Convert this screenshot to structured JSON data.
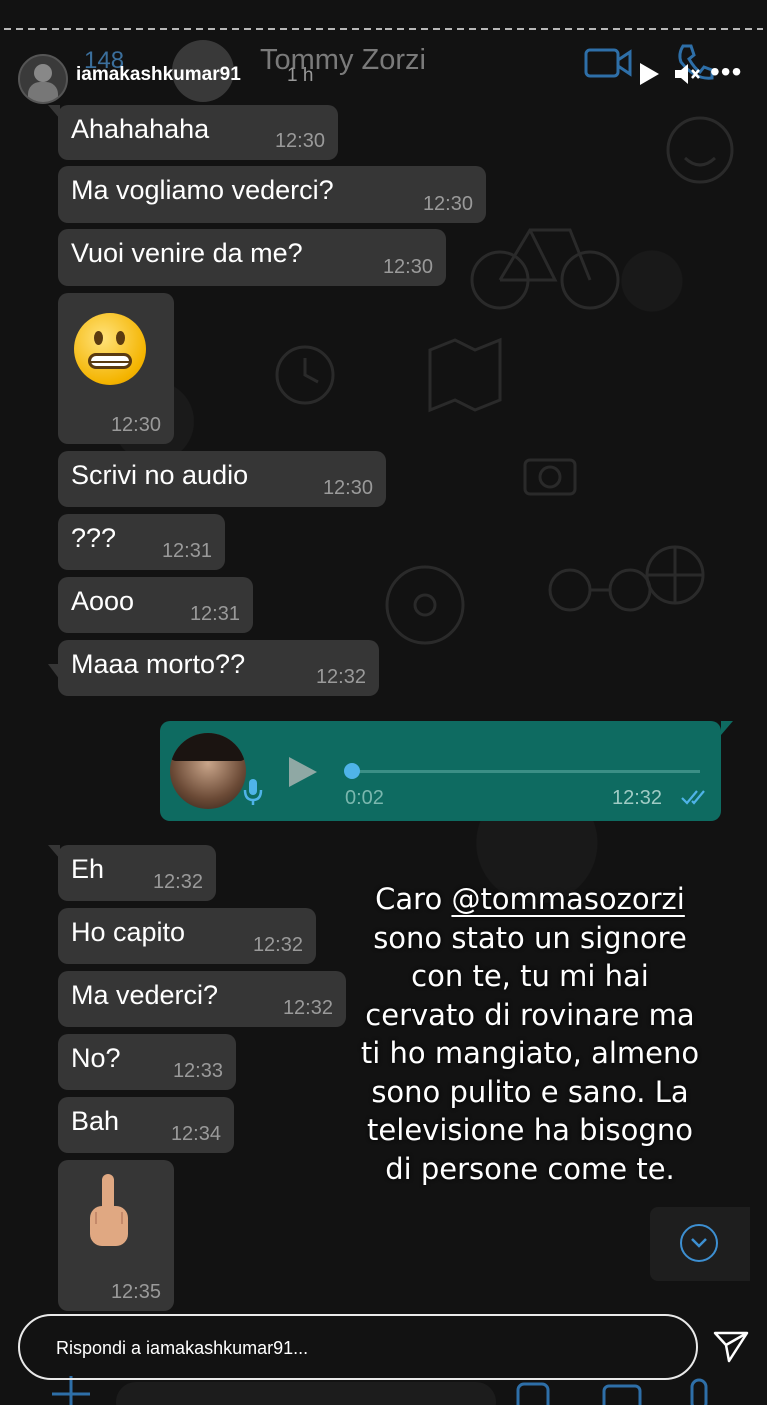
{
  "story": {
    "username": "iamakashkumar91",
    "time_ago": "1 h",
    "reply_placeholder": "Rispondi a iamakashkumar91...",
    "caption": {
      "prefix": "Caro ",
      "mention": "@tommasozorzi",
      "lines": [
        "sono stato un signore",
        "con te, tu mi hai",
        "cervato di rovinare ma",
        "ti ho mangiato, almeno",
        "sono pulito e sano. La",
        "televisione ha bisogno",
        "di persone come te."
      ]
    }
  },
  "chat_header": {
    "contact_name": "Tommy Zorzi",
    "back_count": "148"
  },
  "messages": [
    {
      "text": "Ahahahaha",
      "time": "12:30"
    },
    {
      "text": "Ma vogliamo vederci?",
      "time": "12:30"
    },
    {
      "text": "Vuoi venire da me?",
      "time": "12:30"
    },
    {
      "emoji": "grimacing-face",
      "time": "12:30"
    },
    {
      "text": "Scrivi no audio",
      "time": "12:30"
    },
    {
      "text": "???",
      "time": "12:31"
    },
    {
      "text": "Aooo",
      "time": "12:31"
    },
    {
      "text": "Maaa morto??",
      "time": "12:32"
    },
    {
      "voice_note": true,
      "duration": "0:02",
      "time": "12:32",
      "progress": 0
    },
    {
      "text": "Eh",
      "time": "12:32"
    },
    {
      "text": "Ho capito",
      "time": "12:32"
    },
    {
      "text": "Ma vederci?",
      "time": "12:32"
    },
    {
      "text": "No?",
      "time": "12:33"
    },
    {
      "text": "Bah",
      "time": "12:34"
    },
    {
      "emoji": "middle-finger",
      "time": "12:35"
    }
  ],
  "colors": {
    "incoming_bubble": "#363636",
    "outgoing_bubble": "#0e6b61",
    "accent_blue": "#4fb3e8"
  }
}
